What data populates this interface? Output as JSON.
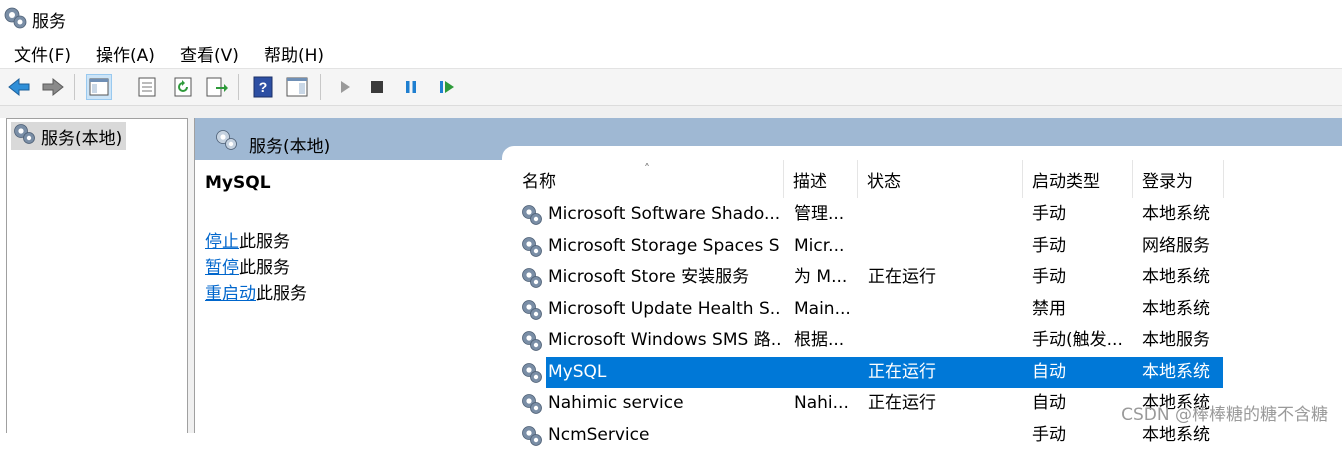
{
  "window": {
    "title": "服务"
  },
  "menu": [
    "文件(F)",
    "操作(A)",
    "查看(V)",
    "帮助(H)"
  ],
  "toolbar": {
    "icons": [
      "back-arrow-icon",
      "forward-arrow-icon",
      "console-tree-icon",
      "properties-icon",
      "refresh-icon",
      "export-list-icon",
      "help-icon",
      "show-hide-pane-icon",
      "start-icon",
      "stop-icon",
      "pause-icon",
      "resume-icon"
    ]
  },
  "tree": {
    "root_label": "服务(本地)"
  },
  "panel": {
    "header_label": "服务(本地)",
    "selected_service": "MySQL",
    "actions": [
      {
        "link": "停止",
        "rest": "此服务"
      },
      {
        "link": "暂停",
        "rest": "此服务"
      },
      {
        "link": "重启动",
        "rest": "此服务"
      }
    ]
  },
  "table": {
    "columns": [
      "名称",
      "描述",
      "状态",
      "启动类型",
      "登录为"
    ],
    "rows": [
      {
        "name": "Microsoft Software Shado...",
        "desc": "管理...",
        "status": "",
        "startup": "手动",
        "logon": "本地系统",
        "selected": false
      },
      {
        "name": "Microsoft Storage Spaces S...",
        "desc": "Micr...",
        "status": "",
        "startup": "手动",
        "logon": "网络服务",
        "selected": false
      },
      {
        "name": "Microsoft Store 安装服务",
        "desc": "为 M...",
        "status": "正在运行",
        "startup": "手动",
        "logon": "本地系统",
        "selected": false
      },
      {
        "name": "Microsoft Update Health S...",
        "desc": "Main...",
        "status": "",
        "startup": "禁用",
        "logon": "本地系统",
        "selected": false
      },
      {
        "name": "Microsoft Windows SMS 路...",
        "desc": "根据...",
        "status": "",
        "startup": "手动(触发...",
        "logon": "本地服务",
        "selected": false
      },
      {
        "name": "MySQL",
        "desc": "",
        "status": "正在运行",
        "startup": "自动",
        "logon": "本地系统",
        "selected": true
      },
      {
        "name": "Nahimic service",
        "desc": "Nahi...",
        "status": "正在运行",
        "startup": "自动",
        "logon": "本地系统",
        "selected": false
      },
      {
        "name": "NcmService",
        "desc": "",
        "status": "",
        "startup": "手动",
        "logon": "本地系统",
        "selected": false
      }
    ]
  },
  "watermark": "CSDN @棒棒糖的糖不含糖",
  "colors": {
    "selection": "#0078d7",
    "panel_header": "#9fb8d3",
    "link": "#0066cc"
  }
}
